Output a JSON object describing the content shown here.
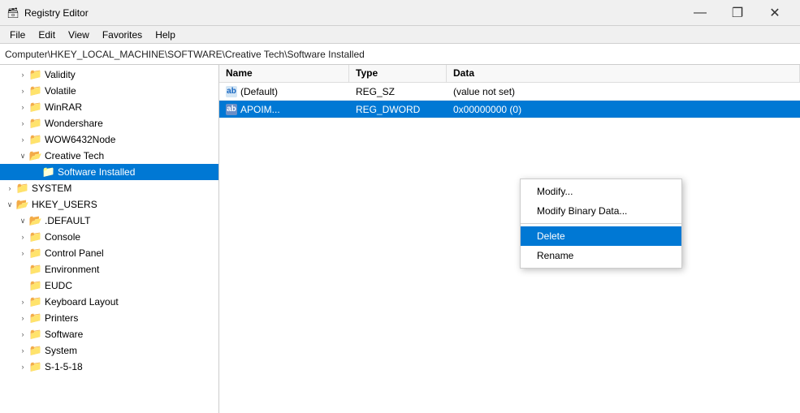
{
  "titleBar": {
    "icon": "🗃",
    "title": "Registry Editor",
    "minimizeLabel": "—",
    "restoreLabel": "❐",
    "closeLabel": "✕"
  },
  "menuBar": {
    "items": [
      "File",
      "Edit",
      "View",
      "Favorites",
      "Help"
    ]
  },
  "addressBar": {
    "path": "Computer\\HKEY_LOCAL_MACHINE\\SOFTWARE\\Creative Tech\\Software Installed"
  },
  "tree": {
    "items": [
      {
        "id": "validity",
        "label": "Validity",
        "indent": "indent-2",
        "expand": "›",
        "hasExpand": true
      },
      {
        "id": "volatile",
        "label": "Volatile",
        "indent": "indent-2",
        "expand": "›",
        "hasExpand": true
      },
      {
        "id": "winrar",
        "label": "WinRAR",
        "indent": "indent-2",
        "expand": "›",
        "hasExpand": true
      },
      {
        "id": "wondershare",
        "label": "Wondershare",
        "indent": "indent-2",
        "expand": "›",
        "hasExpand": true
      },
      {
        "id": "wow6432",
        "label": "WOW6432Node",
        "indent": "indent-2",
        "expand": "›",
        "hasExpand": true
      },
      {
        "id": "creative-tech",
        "label": "Creative Tech",
        "indent": "indent-2",
        "expand": "∨",
        "hasExpand": true
      },
      {
        "id": "software-installed",
        "label": "Software Installed",
        "indent": "indent-3",
        "expand": "",
        "hasExpand": false,
        "selected": true
      },
      {
        "id": "system",
        "label": "SYSTEM",
        "indent": "indent-1",
        "expand": "›",
        "hasExpand": true
      },
      {
        "id": "hkey-users",
        "label": "HKEY_USERS",
        "indent": "indent-0",
        "expand": "∨",
        "hasExpand": true
      },
      {
        "id": "default",
        "label": ".DEFAULT",
        "indent": "indent-1",
        "expand": "∨",
        "hasExpand": true
      },
      {
        "id": "console",
        "label": "Console",
        "indent": "indent-2",
        "expand": "›",
        "hasExpand": true
      },
      {
        "id": "control-panel",
        "label": "Control Panel",
        "indent": "indent-2",
        "expand": "›",
        "hasExpand": true
      },
      {
        "id": "environment",
        "label": "Environment",
        "indent": "indent-2",
        "expand": "",
        "hasExpand": false
      },
      {
        "id": "eudc",
        "label": "EUDC",
        "indent": "indent-2",
        "expand": "",
        "hasExpand": false
      },
      {
        "id": "keyboard-layout",
        "label": "Keyboard Layout",
        "indent": "indent-2",
        "expand": "›",
        "hasExpand": true
      },
      {
        "id": "printers",
        "label": "Printers",
        "indent": "indent-2",
        "expand": "›",
        "hasExpand": true
      },
      {
        "id": "software",
        "label": "Software",
        "indent": "indent-2",
        "expand": "›",
        "hasExpand": true
      },
      {
        "id": "system2",
        "label": "System",
        "indent": "indent-2",
        "expand": "›",
        "hasExpand": true
      },
      {
        "id": "s-1-5-18",
        "label": "S-1-5-18",
        "indent": "indent-1",
        "expand": "›",
        "hasExpand": true
      }
    ]
  },
  "detail": {
    "columns": [
      "Name",
      "Type",
      "Data"
    ],
    "rows": [
      {
        "id": "default-row",
        "icon": "ab",
        "iconType": "string",
        "name": "(Default)",
        "type": "REG_SZ",
        "data": "(value not set)"
      },
      {
        "id": "apoim-row",
        "icon": "ab",
        "iconType": "dword",
        "name": "APOIM...",
        "type": "REG_DWORD",
        "data": "0x00000000 (0)",
        "selected": true
      }
    ]
  },
  "contextMenu": {
    "items": [
      {
        "id": "modify",
        "label": "Modify...",
        "highlighted": false
      },
      {
        "id": "modify-binary",
        "label": "Modify Binary Data...",
        "highlighted": false
      },
      {
        "id": "separator",
        "type": "separator"
      },
      {
        "id": "delete",
        "label": "Delete",
        "highlighted": true
      },
      {
        "id": "rename",
        "label": "Rename",
        "highlighted": false
      }
    ]
  }
}
